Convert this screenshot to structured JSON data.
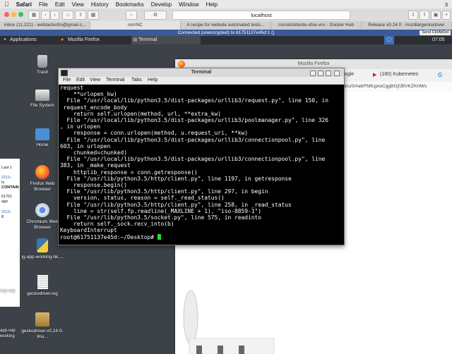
{
  "mac_menu": {
    "apple": "",
    "items": [
      "Safari",
      "File",
      "Edit",
      "View",
      "History",
      "Bookmarks",
      "Develop",
      "Window",
      "Help"
    ],
    "status_right": "3"
  },
  "safari": {
    "url": "localhost",
    "tabs": [
      "inbox (11,221) - webtactechs@gmail.c...",
      "noVNC",
      "A recipe for website automated tests...",
      "consol/ubuntu-xfce-vnc - Docker Hub",
      "Release v0.24.0 · mozilla/geckodriver"
    ]
  },
  "novnc": {
    "status": "Connected (unencrypted) to 61751137e45d:1 ()",
    "ctrl_alt_del": "Send CtrlAltDel"
  },
  "xfce_panel": {
    "applications": "Applications",
    "tasks": [
      "Mozilla Firefox",
      "Terminal"
    ],
    "clock": "07:05"
  },
  "desktop_icons": [
    {
      "label": "Trash",
      "icon": "trash-icon"
    },
    {
      "label": "File System",
      "icon": "drive-icon"
    },
    {
      "label": "Home",
      "icon": "home-folder-icon"
    },
    {
      "label": "Firefox Web Browser",
      "icon": "firefox-icon"
    },
    {
      "label": "Chromium Web Browser",
      "icon": "chromium-icon"
    },
    {
      "label": "ig-app-working-bk....",
      "icon": "python-file-icon"
    },
    {
      "label": "geckodriver.log",
      "icon": "text-file-icon"
    },
    {
      "label": "geckodriver-v0.24.0-linu...",
      "icon": "archive-icon"
    }
  ],
  "left_sliver": [
    "Last 1",
    "2019-",
    "Is ",
    "CONTAIN",
    "61751",
    "ago",
    "2019-",
    "8 ",
    "kup-vap",
    "app-vap",
    "working"
  ],
  "firefox": {
    "title": "Mozilla Firefox",
    "tab_fragment": "oogle",
    "tab2": "(180) Kubernetes",
    "url_fragment": "ail/u/0/#all/FMfcgxwCggBGjfJBVKZKHWs"
  },
  "terminal": {
    "title": "Terminal",
    "menu": [
      "File",
      "Edit",
      "View",
      "Terminal",
      "Tabs",
      "Help"
    ],
    "lines": [
      "request",
      "    **urlopen_kw)",
      "  File \"/usr/local/lib/python3.5/dist-packages/urllib3/request.py\", line 150, in",
      " request_encode_body",
      "    return self.urlopen(method, url, **extra_kw)",
      "  File \"/usr/local/lib/python3.5/dist-packages/urllib3/poolmanager.py\", line 326",
      ", in urlopen",
      "    response = conn.urlopen(method, u.request_uri, **kw)",
      "  File \"/usr/local/lib/python3.5/dist-packages/urllib3/connectionpool.py\", line",
      "603, in urlopen",
      "    chunked=chunked)",
      "  File \"/usr/local/lib/python3.5/dist-packages/urllib3/connectionpool.py\", line",
      "383, in _make_request",
      "    httplib_response = conn.getresponse()",
      "  File \"/usr/lib/python3.5/http/client.py\", line 1197, in getresponse",
      "    response.begin()",
      "  File \"/usr/lib/python3.5/http/client.py\", line 297, in begin",
      "    version, status, reason = self._read_status()",
      "  File \"/usr/lib/python3.5/http/client.py\", line 258, in _read_status",
      "    line = str(self.fp.readline(_MAXLINE + 1), \"iso-8859-1\")",
      "  File \"/usr/lib/python3.5/socket.py\", line 575, in readinto",
      "    return self._sock.recv_into(b)",
      "KeyboardInterrupt"
    ],
    "prompt": "root@61751137e45d:~/Desktop# "
  }
}
